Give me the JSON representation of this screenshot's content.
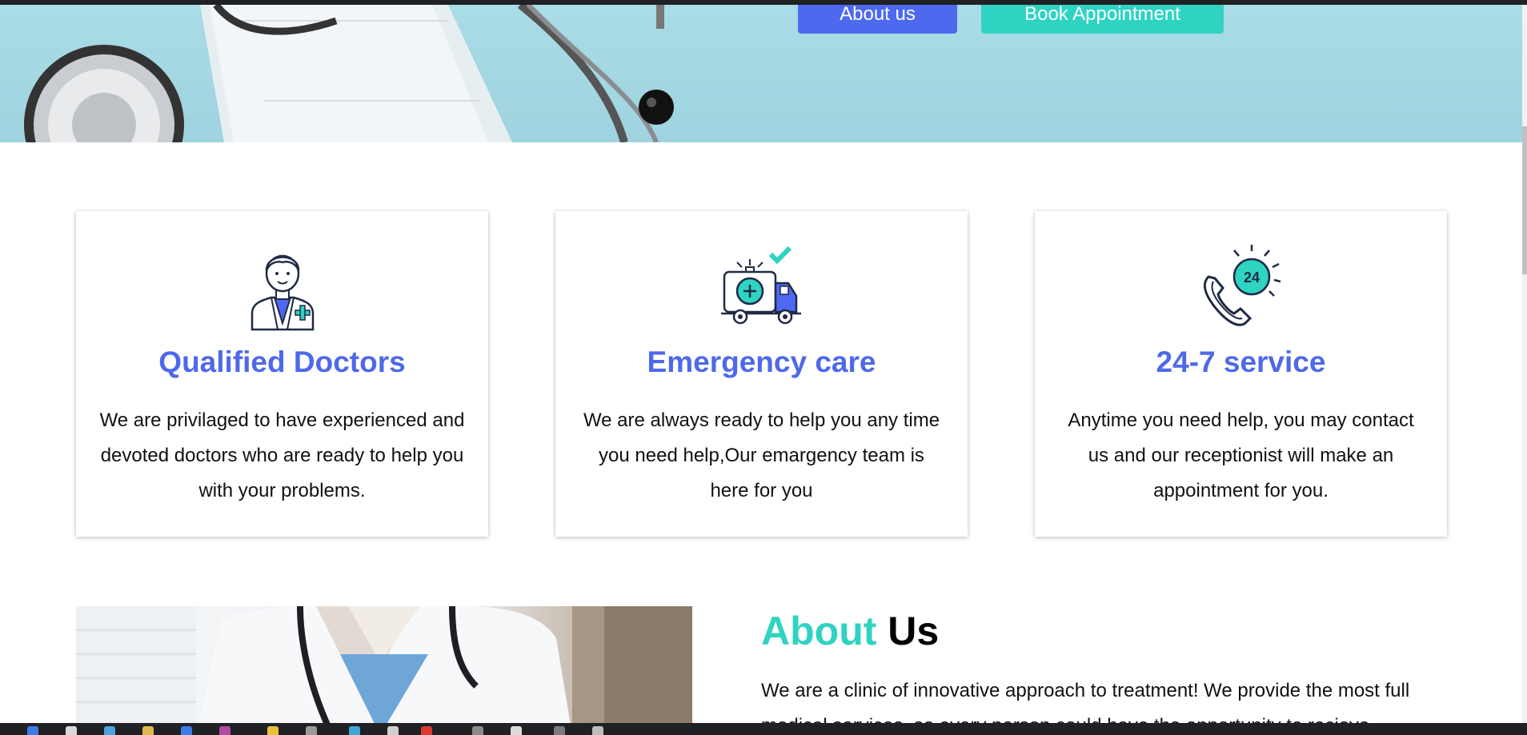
{
  "hero": {
    "about_button": "About us",
    "book_button": "Book Appointment"
  },
  "features": [
    {
      "icon": "doctor-icon",
      "title": "Qualified Doctors",
      "text": "We are privilaged to have experienced and devoted doctors who are ready to help you with your problems."
    },
    {
      "icon": "ambulance-icon",
      "title": "Emergency care",
      "text": "We are always ready to help you any time you need help,Our emargency team is here for you"
    },
    {
      "icon": "phone-24-icon",
      "title": "24-7 service",
      "text": "Anytime you need help, you may contact us and our receptionist will make an appointment for you."
    }
  ],
  "about": {
    "title_accent": "About",
    "title_rest": "Us",
    "text": "We are a clinic of innovative approach to treatment! We provide the most full medical services, so every person could have the opportunity to recieve"
  },
  "colors": {
    "primary": "#4e69f0",
    "teal": "#2fd3c2",
    "heading_blue": "#4e69e8"
  }
}
